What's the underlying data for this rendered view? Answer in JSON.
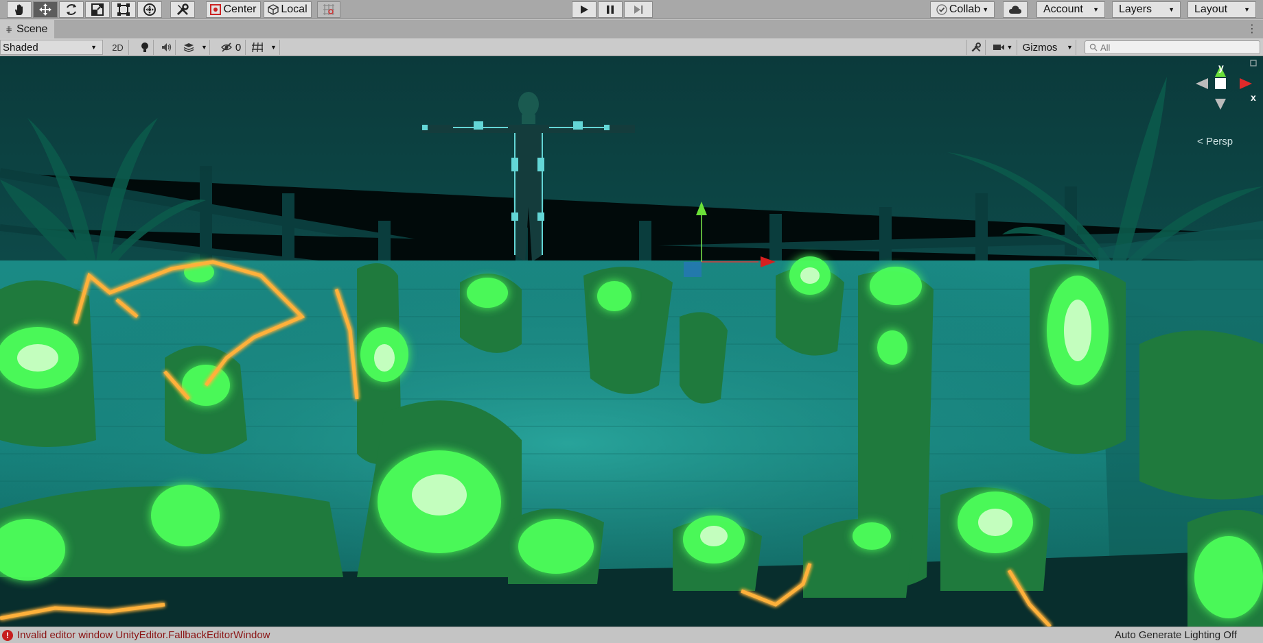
{
  "toolbar": {
    "pivot_label": "Center",
    "handle_label": "Local",
    "collab_label": "Collab",
    "account_label": "Account",
    "layers_label": "Layers",
    "layout_label": "Layout",
    "tools": [
      "hand-tool",
      "move-tool",
      "rotate-tool",
      "scale-tool",
      "rect-tool",
      "transform-tool",
      "custom-tool"
    ]
  },
  "scene_tab": {
    "title": "Scene"
  },
  "scene_bar": {
    "draw_mode": "Shaded",
    "toggle_2d": "2D",
    "hidden_count": "0",
    "gizmos_label": "Gizmos",
    "search_placeholder": "All"
  },
  "viewport": {
    "projection_label": "Persp",
    "axis_y": "y",
    "axis_x": "x"
  },
  "status": {
    "error_message": "Invalid editor window UnityEditor.FallbackEditorWindow",
    "lighting": "Auto Generate Lighting Off"
  },
  "colors": {
    "toolbar_bg": "#a8a8a8",
    "active_tool": "#5a5a5a",
    "error": "#c61d1d",
    "glow_green": "#3cff46",
    "glow_orange": "#ff9a2a"
  }
}
